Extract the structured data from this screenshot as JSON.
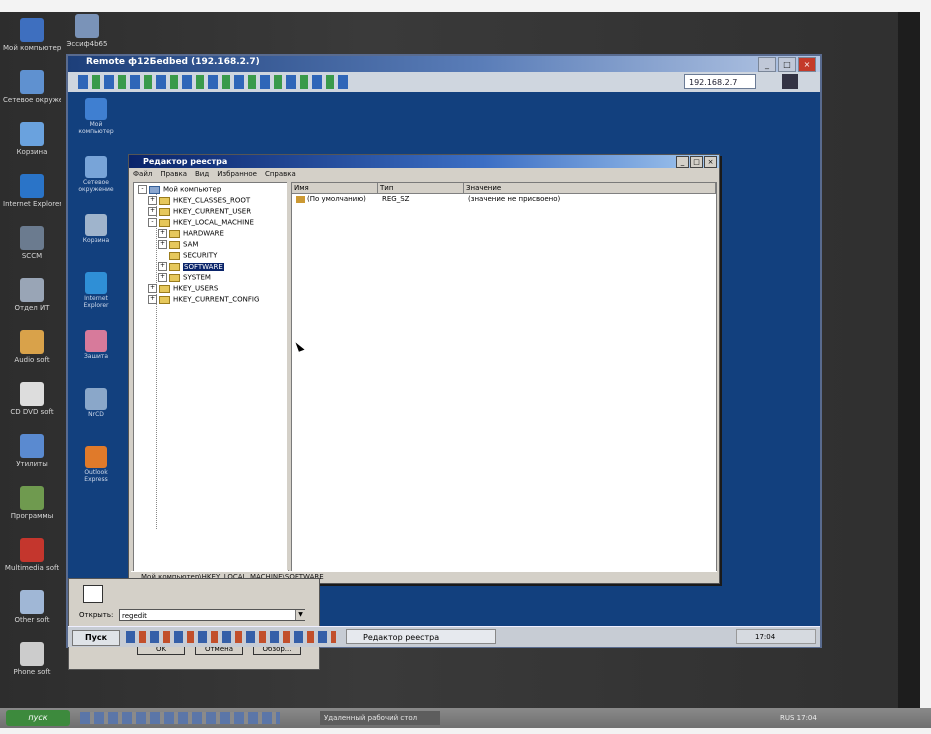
{
  "outer_desktop": {
    "icons": [
      {
        "name": "my-computer-icon",
        "label": "Мой компьютер",
        "color": "#3e6fbf"
      },
      {
        "name": "network-icon",
        "label": "Сетевое окружение",
        "color": "#5f91d0"
      },
      {
        "name": "recycle-icon",
        "label": "Корзина",
        "color": "#6aa2de"
      },
      {
        "name": "ie-icon",
        "label": "Internet Explorer",
        "color": "#2a74c8"
      },
      {
        "name": "app-icon",
        "label": "SCCM",
        "color": "#6b7b8f"
      },
      {
        "name": "folder-icon",
        "label": "Отдел ИТ",
        "color": "#99a5b6"
      },
      {
        "name": "audio-icon",
        "label": "Audio soft",
        "color": "#d9a24a"
      },
      {
        "name": "cd-icon",
        "label": "CD DVD soft",
        "color": "#dddddd"
      },
      {
        "name": "utility-icon",
        "label": "Утилиты",
        "color": "#5a8ad0"
      },
      {
        "name": "windows-icon",
        "label": "Программы",
        "color": "#6f9a4f"
      },
      {
        "name": "multimedia-icon",
        "label": "Multimedia soft",
        "color": "#c4362d"
      },
      {
        "name": "other-icon",
        "label": "Other soft",
        "color": "#a0b7d6"
      },
      {
        "name": "phone-icon",
        "label": "Phone soft",
        "color": "#cccccc"
      }
    ],
    "top_icon": {
      "label": "Эссиф4b65"
    }
  },
  "outer_taskbar": {
    "start_label": "пуск",
    "task_label": "Удаленный рабочий стол",
    "tray_text": "RUS   17:04"
  },
  "remote": {
    "title": "Remote ф12Бedbed (192.168.2.7)",
    "address": "192.168.2.7",
    "desktop_icons": [
      {
        "label": "Мой компьютер",
        "color": "#3f7fd1"
      },
      {
        "label": "Сетевое окружение",
        "color": "#78a4d8"
      },
      {
        "label": "Корзина",
        "color": "#9fb4cc"
      },
      {
        "label": "Internet Explorer",
        "color": "#2f8fd6"
      },
      {
        "label": "Зашита",
        "color": "#d77a9b"
      },
      {
        "label": "NrCD",
        "color": "#8aa7c9"
      },
      {
        "label": "Outlook Express",
        "color": "#e07a2a"
      }
    ],
    "taskbar": {
      "start_label": "Пуск",
      "task_label": "Редактор реестра",
      "tray_text": "17:04"
    }
  },
  "regedit": {
    "title": "Редактор реестра",
    "menu": [
      "Файл",
      "Правка",
      "Вид",
      "Избранное",
      "Справка"
    ],
    "tree": [
      {
        "label": "Мой компьютер",
        "level": 0,
        "toggle": "-"
      },
      {
        "label": "HKEY_CLASSES_ROOT",
        "level": 1,
        "toggle": "+"
      },
      {
        "label": "HKEY_CURRENT_USER",
        "level": 1,
        "toggle": "+"
      },
      {
        "label": "HKEY_LOCAL_MACHINE",
        "level": 1,
        "toggle": "-"
      },
      {
        "label": "HARDWARE",
        "level": 2,
        "toggle": "+"
      },
      {
        "label": "SAM",
        "level": 2,
        "toggle": "+"
      },
      {
        "label": "SECURITY",
        "level": 2,
        "toggle": ""
      },
      {
        "label": "SOFTWARE",
        "level": 2,
        "toggle": "+",
        "selected": true
      },
      {
        "label": "SYSTEM",
        "level": 2,
        "toggle": "+"
      },
      {
        "label": "HKEY_USERS",
        "level": 1,
        "toggle": "+"
      },
      {
        "label": "HKEY_CURRENT_CONFIG",
        "level": 1,
        "toggle": "+"
      }
    ],
    "columns": [
      "Имя",
      "Тип",
      "Значение"
    ],
    "rows": [
      {
        "name": "(По умолчанию)",
        "type": "REG_SZ",
        "value": "(значение не присвоено)"
      }
    ],
    "status": "Мой компьютер\\HKEY_LOCAL_MACHINE\\SOFTWARE"
  },
  "run_dialog": {
    "open_label": "Открыть:",
    "input_value": "regedit",
    "ok_label": "OK",
    "cancel_label": "Отмена",
    "browse_label": "Обзор..."
  }
}
